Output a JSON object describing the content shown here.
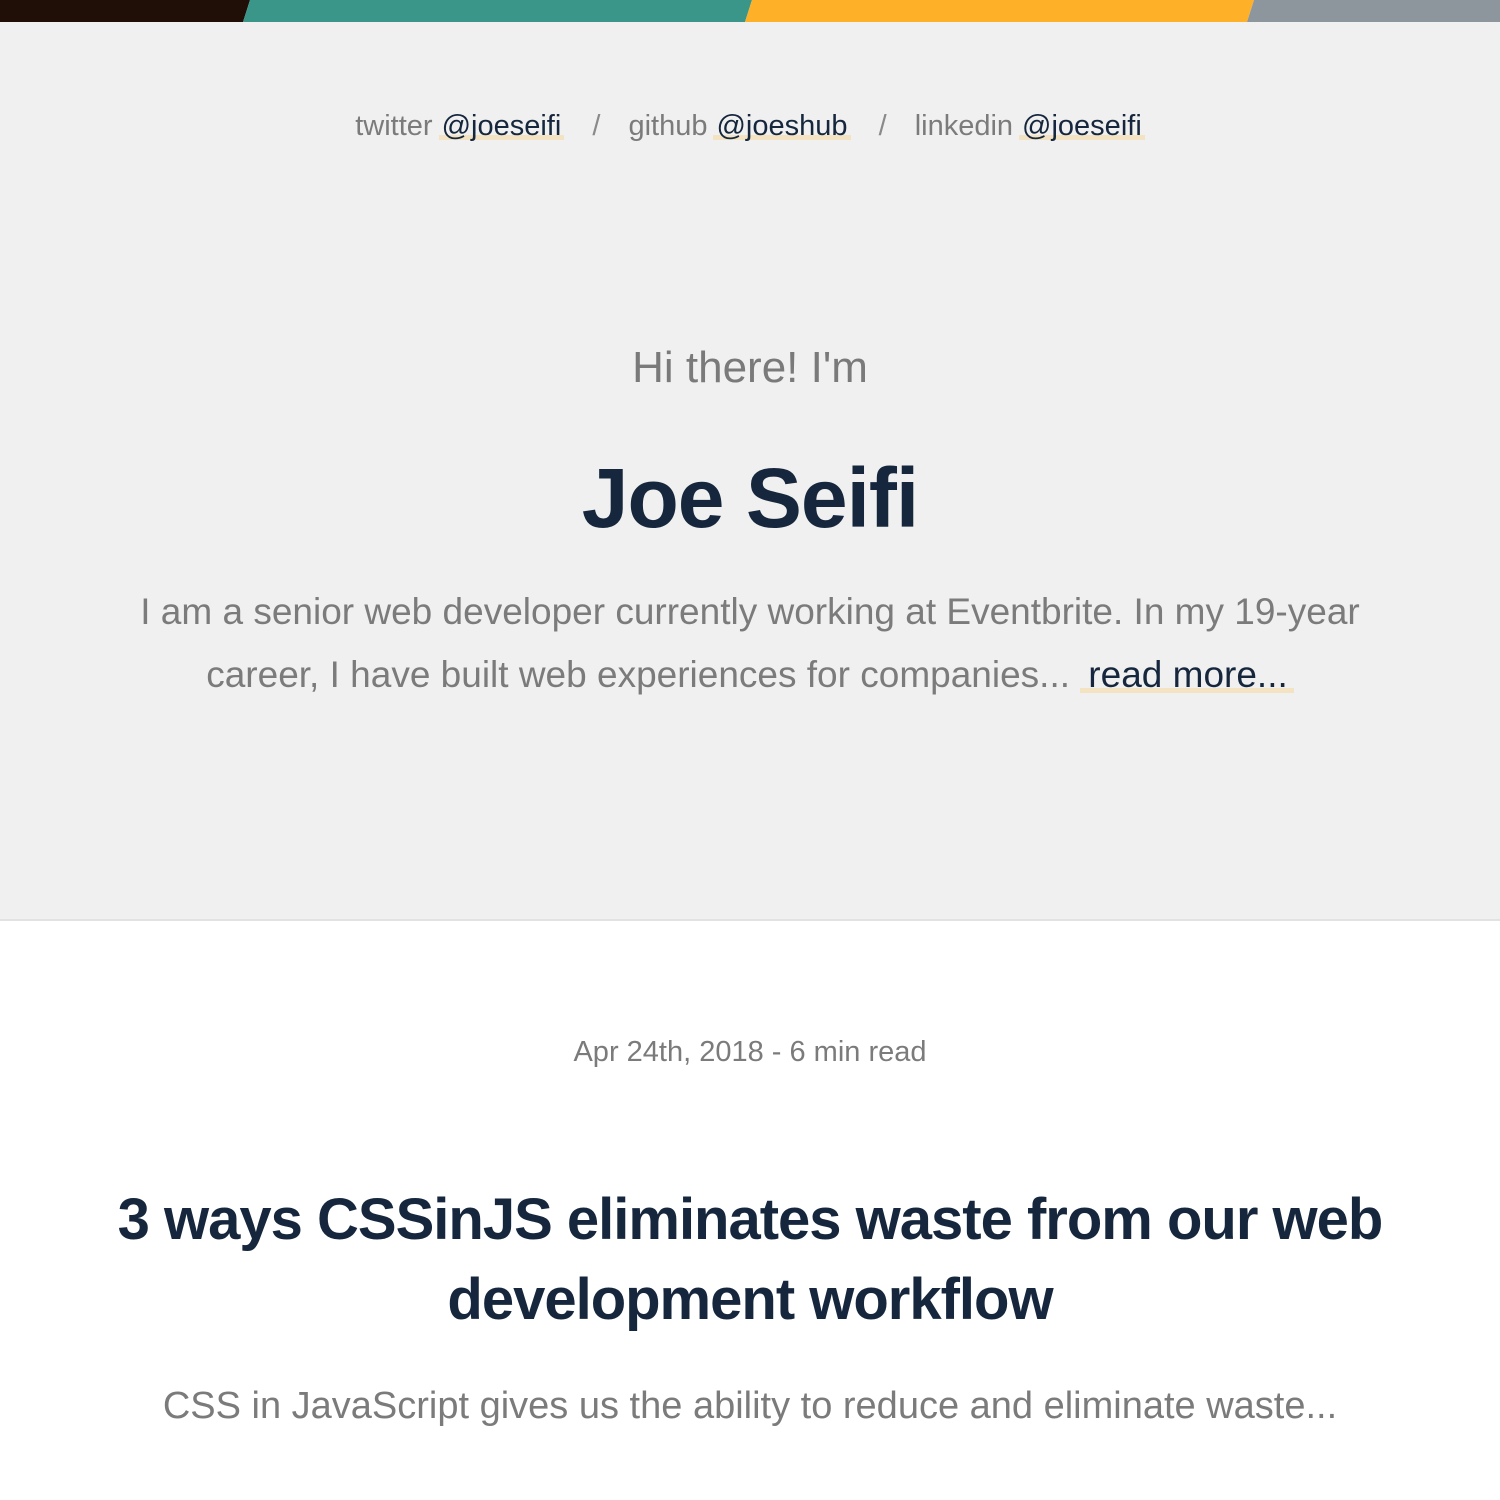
{
  "colors": {
    "topbar": [
      "#1f0f06",
      "#3a9688",
      "#ffb029",
      "#8e969d"
    ],
    "hero_bg": "#f0f0f0",
    "heading": "#16273d",
    "muted": "#7b7b7b",
    "link_highlight": "#f3e3c3"
  },
  "social": {
    "separator": "/",
    "twitter": {
      "label": "twitter",
      "handle": "@joeseifi"
    },
    "github": {
      "label": "github",
      "handle": "@joeshub"
    },
    "linkedin": {
      "label": "linkedin",
      "handle": "@joeseifi"
    }
  },
  "hero": {
    "greeting": "Hi there! I'm",
    "name": "Joe Seifi",
    "intro": "I am a senior web developer currently working at Eventbrite. In my 19-year career, I have built web experiences for companies...",
    "read_more": "read more..."
  },
  "article": {
    "meta": "Apr 24th, 2018 - 6 min read",
    "title": "3 ways CSSinJS eliminates waste from our web development workflow",
    "excerpt": "CSS in JavaScript gives us the ability to reduce and eliminate waste..."
  }
}
